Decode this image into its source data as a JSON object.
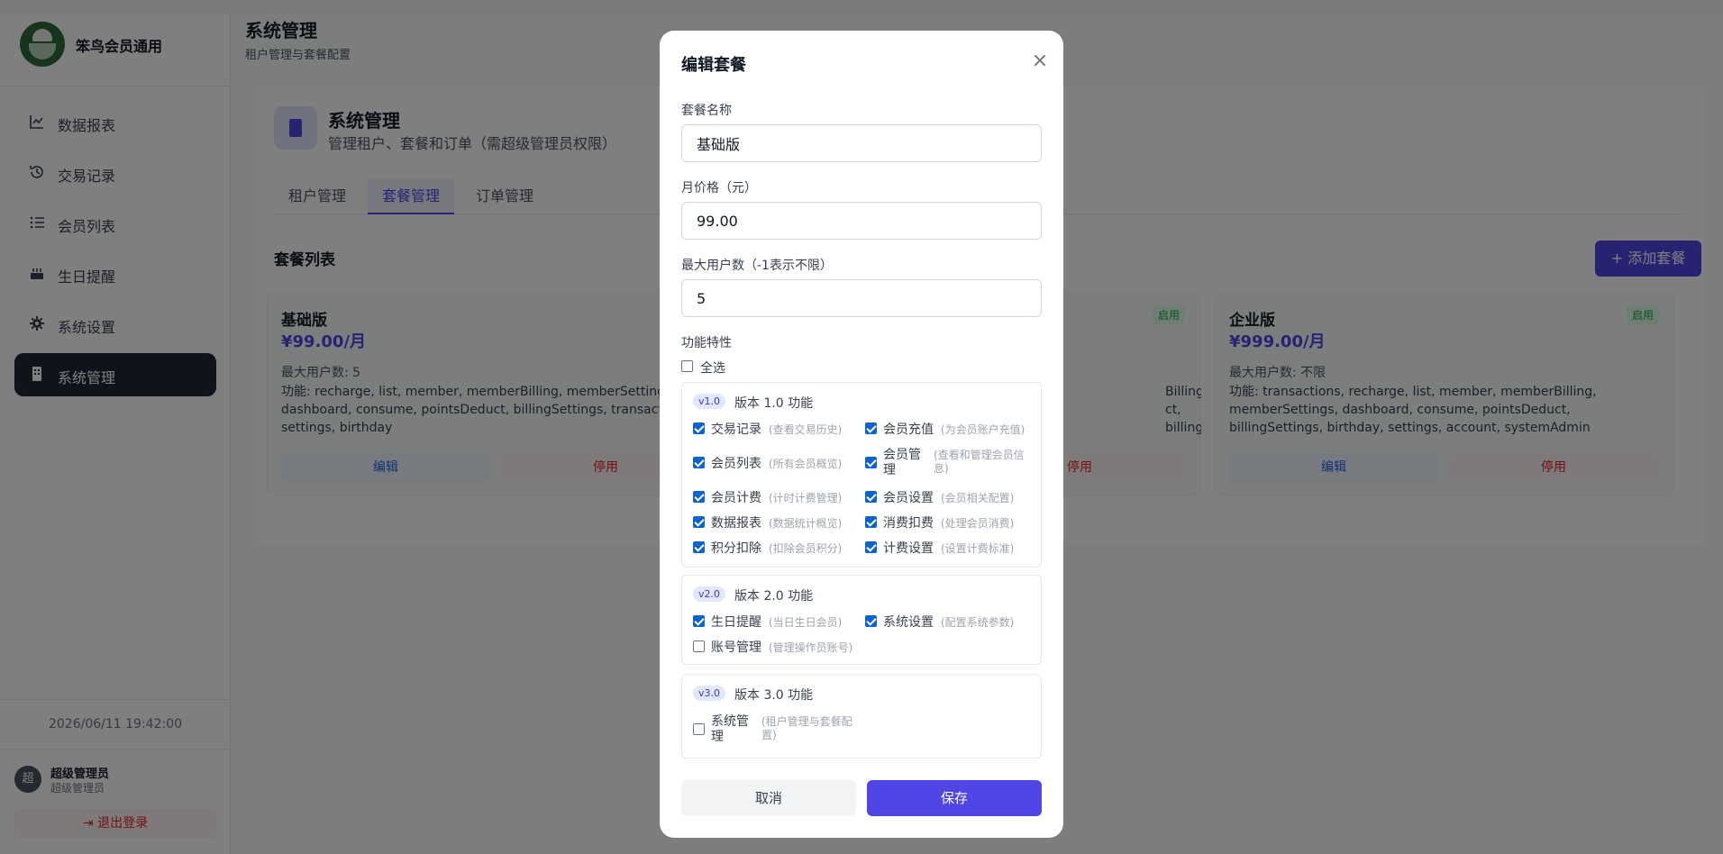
{
  "app": {
    "brand": "笨鸟会员通用",
    "datetime": "2026/06/11 19:42:00",
    "nav": [
      {
        "label": "数据报表",
        "icon": "chart-line-icon"
      },
      {
        "label": "交易记录",
        "icon": "history-icon"
      },
      {
        "label": "会员列表",
        "icon": "list-icon"
      },
      {
        "label": "生日提醒",
        "icon": "cake-icon"
      },
      {
        "label": "系统设置",
        "icon": "gear-icon"
      },
      {
        "label": "系统管理",
        "icon": "building-icon"
      }
    ],
    "active_nav": "系统管理",
    "user": {
      "avatar": "超",
      "name": "超级管理员",
      "role": "超级管理员"
    },
    "logout": "退出登录"
  },
  "page": {
    "title": "系统管理",
    "subtitle": "租户管理与套餐配置",
    "card_title": "系统管理",
    "card_subtitle": "管理租户、套餐和订单（需超级管理员权限）",
    "tabs": [
      "租户管理",
      "套餐管理",
      "订单管理"
    ],
    "active_tab": "套餐管理",
    "section_title": "套餐列表",
    "add_button": "添加套餐",
    "plans": [
      {
        "name": "基础版",
        "price": "¥99.00/月",
        "max_users": "最大用户数: 5",
        "features": "功能: recharge, list, member, memberBilling, memberSettings, dashboard, consume, pointsDeduct, billingSettings, transactio settings, birthday",
        "status": "",
        "edit": "编辑",
        "disable": "停用"
      },
      {
        "name": "",
        "price": "",
        "max_users": "",
        "features": "Billing, ct, billingSettings,",
        "status": "启用",
        "edit": "",
        "disable": "停用"
      },
      {
        "name": "企业版",
        "price": "¥999.00/月",
        "max_users": "最大用户数: 不限",
        "features": "功能: transactions, recharge, list, member, memberBilling, memberSettings, dashboard, consume, pointsDeduct, billingSettings, birthday, settings, account, systemAdmin",
        "status": "启用",
        "edit": "编辑",
        "disable": "停用"
      }
    ]
  },
  "modal": {
    "title": "编辑套餐",
    "close": "×",
    "name_label": "套餐名称",
    "name_value": "基础版",
    "price_label": "月价格（元）",
    "price_value": "99.00",
    "max_users_label": "最大用户数（-1表示不限）",
    "max_users_value": "5",
    "features_label": "功能特性",
    "select_all": "全选",
    "select_all_checked": false,
    "groups": [
      {
        "version": "v1.0",
        "label": "版本 1.0 功能",
        "items": [
          {
            "label": "交易记录",
            "desc": "(查看交易历史)",
            "checked": true
          },
          {
            "label": "会员充值",
            "desc": "(为会员账户充值)",
            "checked": true
          },
          {
            "label": "会员列表",
            "desc": "(所有会员概览)",
            "checked": true
          },
          {
            "label": "会员管理",
            "desc": "(查看和管理会员信息)",
            "checked": true
          },
          {
            "label": "会员计费",
            "desc": "(计时计费管理)",
            "checked": true
          },
          {
            "label": "会员设置",
            "desc": "(会员相关配置)",
            "checked": true
          },
          {
            "label": "数据报表",
            "desc": "(数据统计概览)",
            "checked": true
          },
          {
            "label": "消费扣费",
            "desc": "(处理会员消费)",
            "checked": true
          },
          {
            "label": "积分扣除",
            "desc": "(扣除会员积分)",
            "checked": true
          },
          {
            "label": "计费设置",
            "desc": "(设置计费标准)",
            "checked": true
          }
        ]
      },
      {
        "version": "v2.0",
        "label": "版本 2.0 功能",
        "items": [
          {
            "label": "生日提醒",
            "desc": "(当日生日会员)",
            "checked": true
          },
          {
            "label": "系统设置",
            "desc": "(配置系统参数)",
            "checked": true
          },
          {
            "label": "账号管理",
            "desc": "(管理操作员账号)",
            "checked": false
          }
        ]
      },
      {
        "version": "v3.0",
        "label": "版本 3.0 功能",
        "items": [
          {
            "label": "系统管理",
            "desc": "(租户管理与套餐配置)",
            "checked": false
          }
        ]
      }
    ],
    "cancel": "取消",
    "save": "保存"
  },
  "colors": {
    "primary": "#4f46e5",
    "sidebar_active": "#1f2937",
    "danger": "#dc2626",
    "success": "#16a34a",
    "checkbox": "#0b63ce"
  }
}
